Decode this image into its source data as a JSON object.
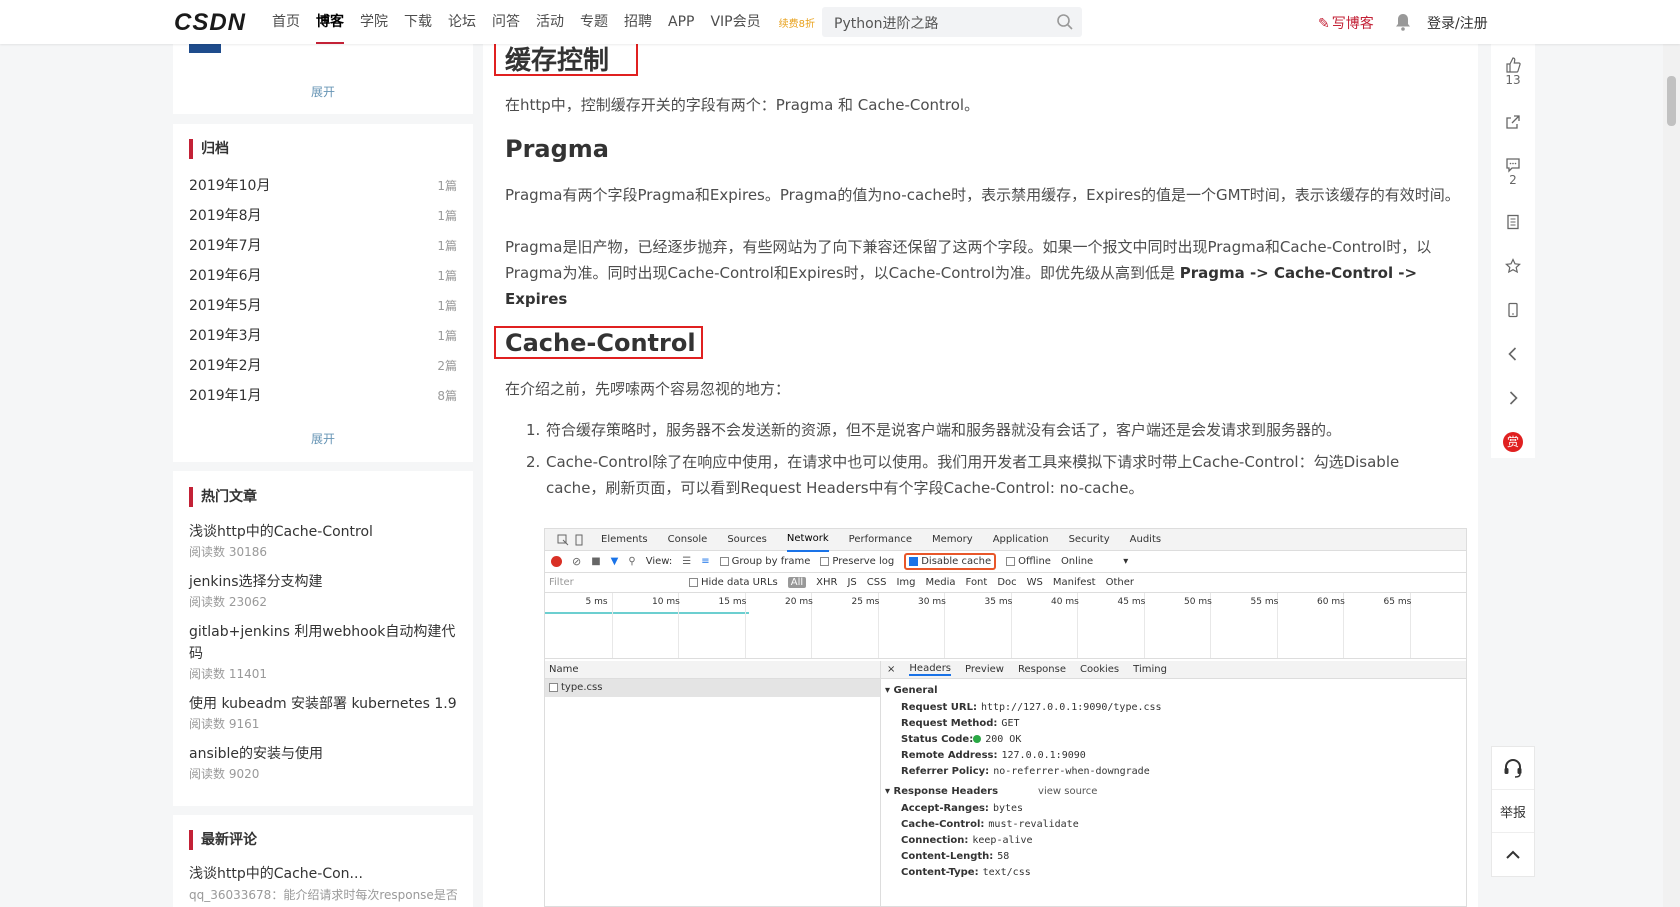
{
  "topbar": {
    "logo_a": "C",
    "logo_b": "SDN",
    "nav": [
      "首页",
      "博客",
      "学院",
      "下载",
      "论坛",
      "问答",
      "活动",
      "专题",
      "招聘",
      "APP",
      "VIP会员"
    ],
    "nav_active": "博客",
    "vip_tag": "续费8折",
    "search_value": "Python进阶之路",
    "write_label": "写博客",
    "login_label": "登录/注册"
  },
  "sidebar": {
    "expand_label": "展开",
    "archive": {
      "title": "归档",
      "items": [
        {
          "month": "2019年10月",
          "count": "1篇"
        },
        {
          "month": "2019年8月",
          "count": "1篇"
        },
        {
          "month": "2019年7月",
          "count": "1篇"
        },
        {
          "month": "2019年6月",
          "count": "1篇"
        },
        {
          "month": "2019年5月",
          "count": "1篇"
        },
        {
          "month": "2019年3月",
          "count": "1篇"
        },
        {
          "month": "2019年2月",
          "count": "2篇"
        },
        {
          "month": "2019年1月",
          "count": "8篇"
        }
      ]
    },
    "hot": {
      "title": "热门文章",
      "items": [
        {
          "title": "浅谈http中的Cache-Control",
          "reads": "阅读数 30186"
        },
        {
          "title": "jenkins选择分支构建",
          "reads": "阅读数 23062"
        },
        {
          "title": "gitlab+jenkins 利用webhook自动构建代码",
          "reads": "阅读数 11401"
        },
        {
          "title": "使用 kubeadm 安装部署 kubernetes 1.9",
          "reads": "阅读数 9161"
        },
        {
          "title": "ansible的安装与使用",
          "reads": "阅读数 9020"
        }
      ]
    },
    "comments": {
      "title": "最新评论",
      "item_title": "浅谈http中的Cache-Con...",
      "item_text": "qq_36033678：能介绍请求时每次response是否"
    }
  },
  "article": {
    "h_cache": "缓存控制",
    "p_intro": "在http中，控制缓存开关的字段有两个：Pragma 和 Cache-Control。",
    "h_pragma": "Pragma",
    "p_pragma1": "Pragma有两个字段Pragma和Expires。Pragma的值为no-cache时，表示禁用缓存，Expires的值是一个GMT时间，表示该缓存的有效时间。",
    "p_pragma2": "Pragma是旧产物，已经逐步抛弃，有些网站为了向下兼容还保留了这两个字段。如果一个报文中同时出现Pragma和Cache-Control时，以Pragma为准。同时出现Cache-Control和Expires时，以Cache-Control为准。即优先级从高到低是 ",
    "p_pragma2_bold": "Pragma -> Cache-Control -> Expires",
    "h_cc": "Cache-Control",
    "p_cc_intro": "在介绍之前，先啰嗦两个容易忽视的地方：",
    "list": [
      {
        "n": "1.",
        "text": "符合缓存策略时，服务器不会发送新的资源，但不是说客户端和服务器就没有会话了，客户端还是会发请求到服务器的。"
      },
      {
        "n": "2.",
        "text": "Cache-Control除了在响应中使用，在请求中也可以使用。我们用开发者工具来模拟下请求时带上Cache-Control：勾选Disable cache，刷新页面，可以看到Request Headers中有个字段Cache-Control: no-cache。"
      }
    ]
  },
  "devtools": {
    "tabs": [
      "Elements",
      "Console",
      "Sources",
      "Network",
      "Performance",
      "Memory",
      "Application",
      "Security",
      "Audits"
    ],
    "active_tab": "Network",
    "view_label": "View:",
    "group_by_frame": "Group by frame",
    "preserve_log": "Preserve log",
    "disable_cache": "Disable cache",
    "offline": "Offline",
    "online": "Online",
    "filter_placeholder": "Filter",
    "hide_data_urls": "Hide data URLs",
    "types": [
      "All",
      "XHR",
      "JS",
      "CSS",
      "Img",
      "Media",
      "Font",
      "Doc",
      "WS",
      "Manifest",
      "Other"
    ],
    "ticks": [
      "5 ms",
      "10 ms",
      "15 ms",
      "20 ms",
      "25 ms",
      "30 ms",
      "35 ms",
      "40 ms",
      "45 ms",
      "50 ms",
      "55 ms",
      "60 ms",
      "65 ms"
    ],
    "name_header": "Name",
    "file": "type.css",
    "detail_tabs": [
      "Headers",
      "Preview",
      "Response",
      "Cookies",
      "Timing"
    ],
    "general_title": "General",
    "general": [
      {
        "k": "Request URL:",
        "v": "http://127.0.0.1:9090/type.css"
      },
      {
        "k": "Request Method:",
        "v": "GET"
      },
      {
        "k": "Status Code:",
        "v": "200 OK"
      },
      {
        "k": "Remote Address:",
        "v": "127.0.0.1:9090"
      },
      {
        "k": "Referrer Policy:",
        "v": "no-referrer-when-downgrade"
      }
    ],
    "resp_title": "Response Headers",
    "view_source": "view source",
    "resp": [
      {
        "k": "Accept-Ranges:",
        "v": "bytes"
      },
      {
        "k": "Cache-Control:",
        "v": "must-revalidate"
      },
      {
        "k": "Connection:",
        "v": "keep-alive"
      },
      {
        "k": "Content-Length:",
        "v": "58"
      },
      {
        "k": "Content-Type:",
        "v": "text/css"
      }
    ]
  },
  "rail": {
    "like_count": "13",
    "comment_count": "2",
    "report_label": "举报",
    "reward_label": "赏"
  }
}
